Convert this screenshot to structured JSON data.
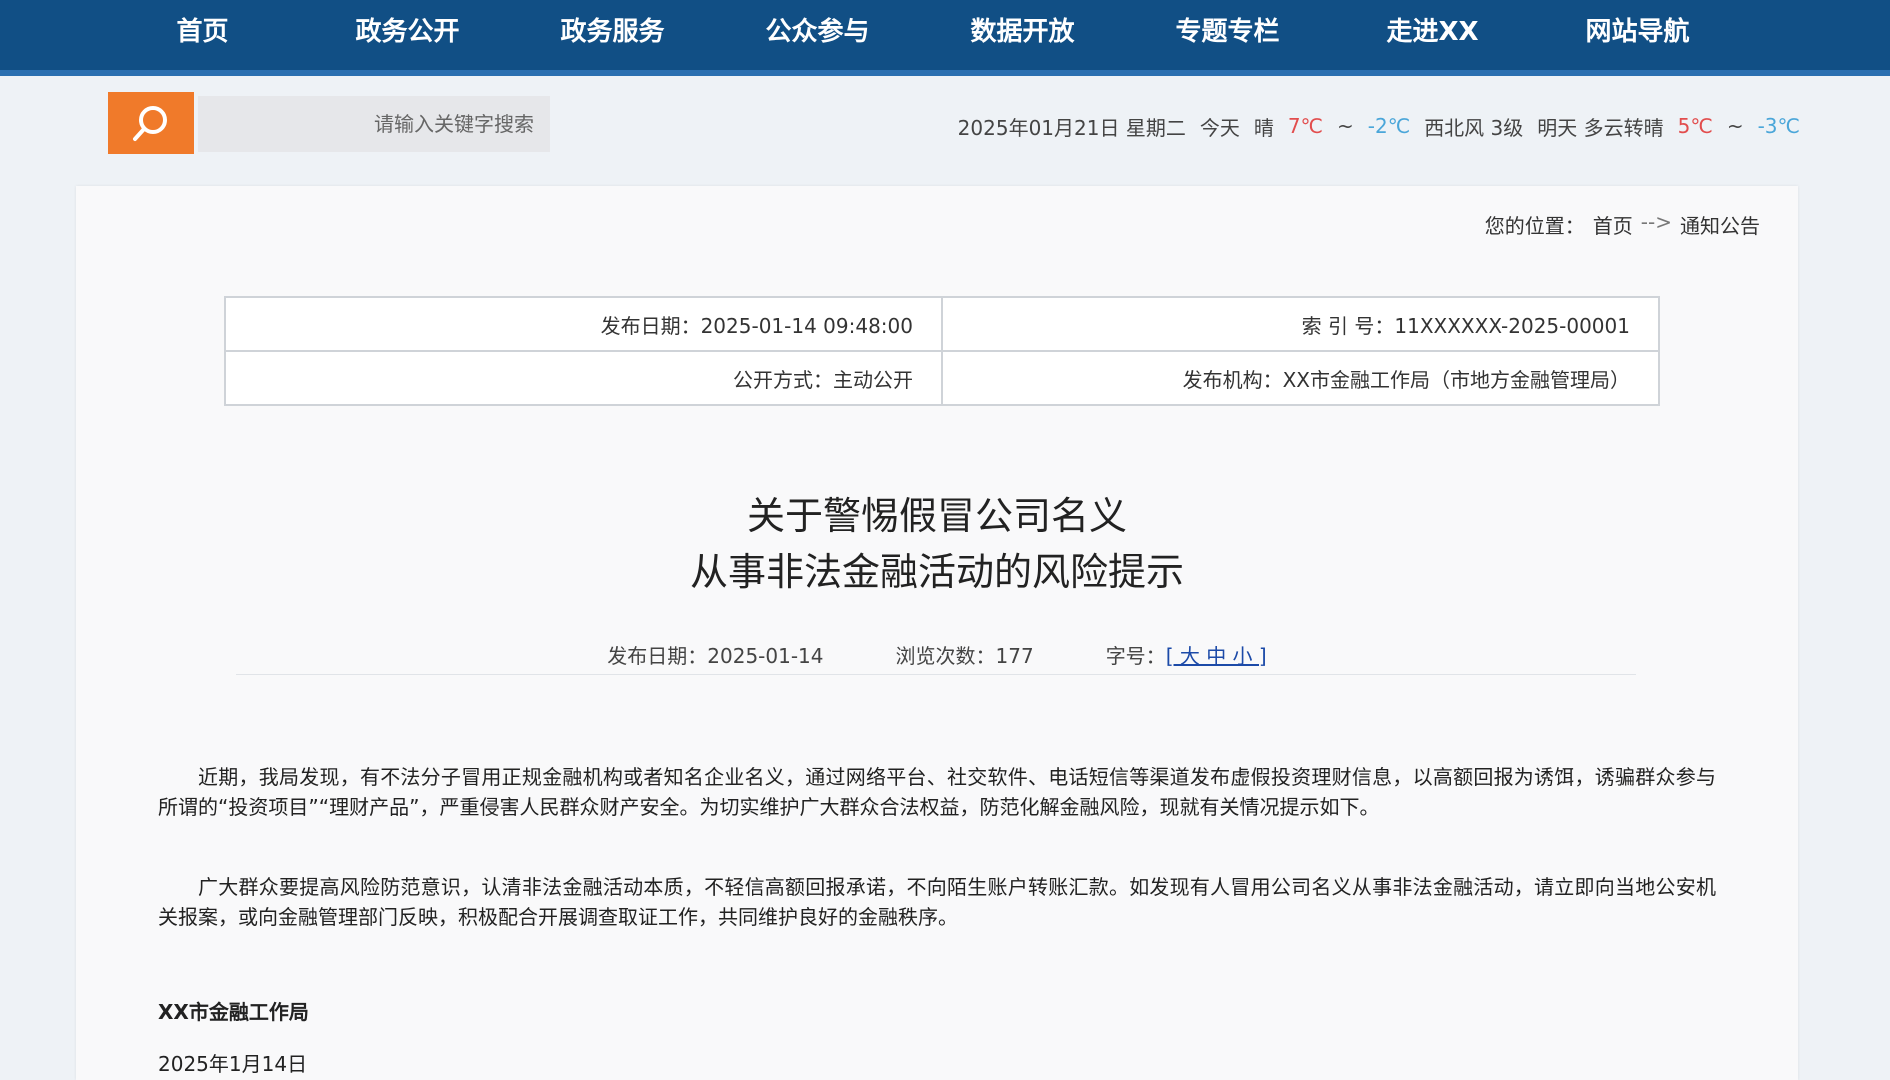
{
  "nav": {
    "items": [
      "首页",
      "政务公开",
      "政务服务",
      "公众参与",
      "数据开放",
      "专题专栏",
      "走进XX",
      "网站导航"
    ]
  },
  "search": {
    "placeholder": "请输入关键字搜索"
  },
  "weather": {
    "date": "2025年01月21日 星期二",
    "city": "今天",
    "condition": "晴",
    "temp_hi": "7℃",
    "sep1": "~",
    "temp_lo": "-2℃",
    "wind": "西北风 3级",
    "tomorrow": "明天 多云转晴",
    "temp_hi2": "5℃",
    "sep2": "~",
    "temp_lo2": "-3℃"
  },
  "breadcrumb": {
    "home": "您的位置：",
    "level1": "首页",
    "sep": "-->",
    "level2": "通知公告"
  },
  "meta_table": {
    "rows": [
      [
        "索 引 号：11XXXXXX-2025-00001",
        "发布日期：2025-01-14 09:48:00"
      ],
      [
        "发布机构：XX市金融工作局（市地方金融管理局）",
        "公开方式：主动公开"
      ]
    ]
  },
  "doc": {
    "title_line1": "关于警惕假冒公司名义",
    "title_line2": "从事非法金融活动的风险提示",
    "pub_date": "发布日期：2025-01-14",
    "views": "浏览次数：177",
    "font_size_label": "字号：",
    "font_size_options": "[ 大 中 小 ]",
    "paragraph1": "近期，我局发现，有不法分子冒用正规金融机构或者知名企业名义，通过网络平台、社交软件、电话短信等渠道发布虚假投资理财信息，以高额回报为诱饵，诱骗群众参与所谓的“投资项目”“理财产品”，严重侵害人民群众财产安全。为切实维护广大群众合法权益，防范化解金融风险，现就有关情况提示如下。",
    "paragraph2": "广大群众要提高风险防范意识，认清非法金融活动本质，不轻信高额回报承诺，不向陌生账户转账汇款。如发现有人冒用公司名义从事非法金融活动，请立即向当地公安机关报案，或向金融管理部门反映，积极配合开展调查取证工作，共同维护良好的金融秩序。",
    "signature": "XX市金融工作局",
    "sign_date": "2025年1月14日"
  }
}
